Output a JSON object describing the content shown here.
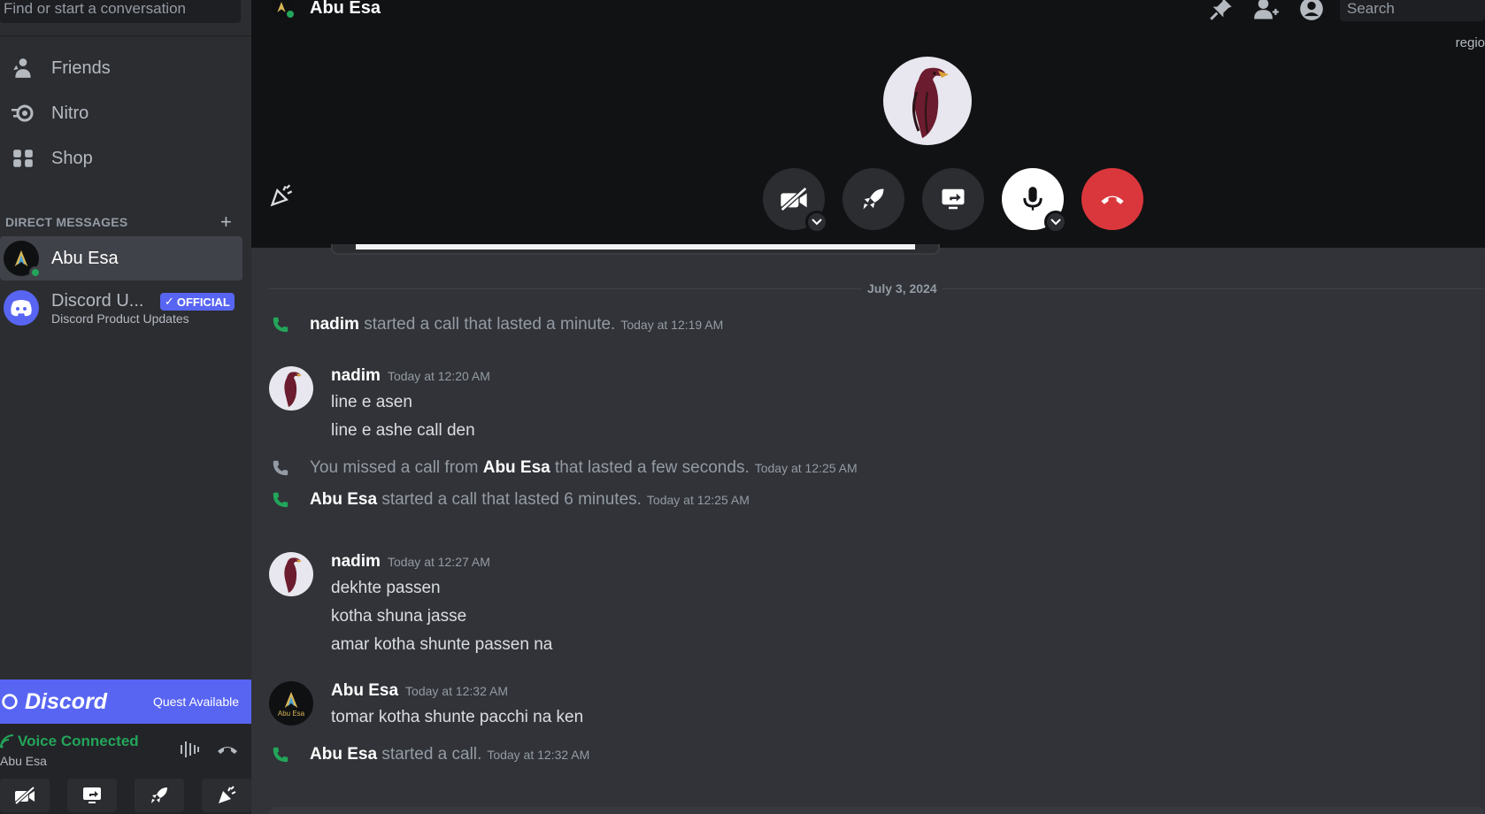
{
  "sidebar": {
    "search_placeholder": "Find or start a conversation",
    "nav": [
      {
        "label": "Friends",
        "icon": "friends-icon"
      },
      {
        "label": "Nitro",
        "icon": "nitro-icon"
      },
      {
        "label": "Shop",
        "icon": "shop-icon"
      }
    ],
    "dm_header": "DIRECT MESSAGES",
    "dm_add": "+",
    "dms": [
      {
        "name": "Abu Esa",
        "status": "online",
        "active": true
      },
      {
        "name": "Discord U...",
        "badge": "OFFICIAL",
        "subtitle": "Discord Product Updates"
      }
    ],
    "quest": {
      "brand": "Discord",
      "text": "Quest Available"
    },
    "voice": {
      "status": "Voice Connected",
      "channel": "Abu Esa"
    }
  },
  "header": {
    "title": "Abu Esa",
    "search_placeholder": "Search",
    "region": "regio"
  },
  "messages": {
    "date_separator": "July 3, 2024",
    "items": [
      {
        "type": "system",
        "author": "nadim",
        "text": "started a call that lasted a minute.",
        "time": "Today at 12:19 AM"
      },
      {
        "type": "message",
        "author": "nadim",
        "time": "Today at 12:20 AM",
        "lines": [
          "line e asen",
          "line e ashe call den"
        ]
      },
      {
        "type": "system-missed",
        "prefix": "You missed a call from",
        "author": "Abu Esa",
        "text": "that lasted a few seconds.",
        "time": "Today at 12:25 AM"
      },
      {
        "type": "system",
        "author": "Abu Esa",
        "text": "started a call that lasted 6 minutes.",
        "time": "Today at 12:25 AM"
      },
      {
        "type": "message",
        "author": "nadim",
        "time": "Today at 12:27 AM",
        "lines": [
          "dekhte passen",
          "kotha shuna jasse",
          "amar kotha shunte passen na"
        ]
      },
      {
        "type": "message",
        "author": "Abu Esa",
        "time": "Today at 12:32 AM",
        "lines": [
          "tomar kotha shunte pacchi na ken"
        ]
      },
      {
        "type": "system",
        "author": "Abu Esa",
        "text": "started a call.",
        "time": "Today at 12:32 AM"
      }
    ]
  },
  "avatar_text": "Abu Esa",
  "colors": {
    "accent": "#5865f2",
    "online": "#23a55a",
    "hangup": "#da373c"
  }
}
